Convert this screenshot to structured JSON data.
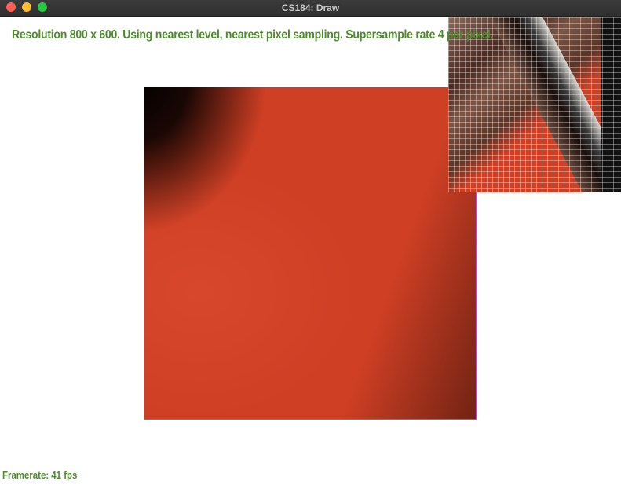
{
  "window": {
    "title": "CS184: Draw"
  },
  "overlay": {
    "status_text": "Resolution 800 x 600. Using nearest level, nearest pixel sampling. Supersample rate 4 per pixel.",
    "framerate_text": "Framerate: 41 fps"
  },
  "colors": {
    "status_text": "#4e8a2e",
    "background_red": "#cf3f24",
    "titlebar": "#343434"
  }
}
